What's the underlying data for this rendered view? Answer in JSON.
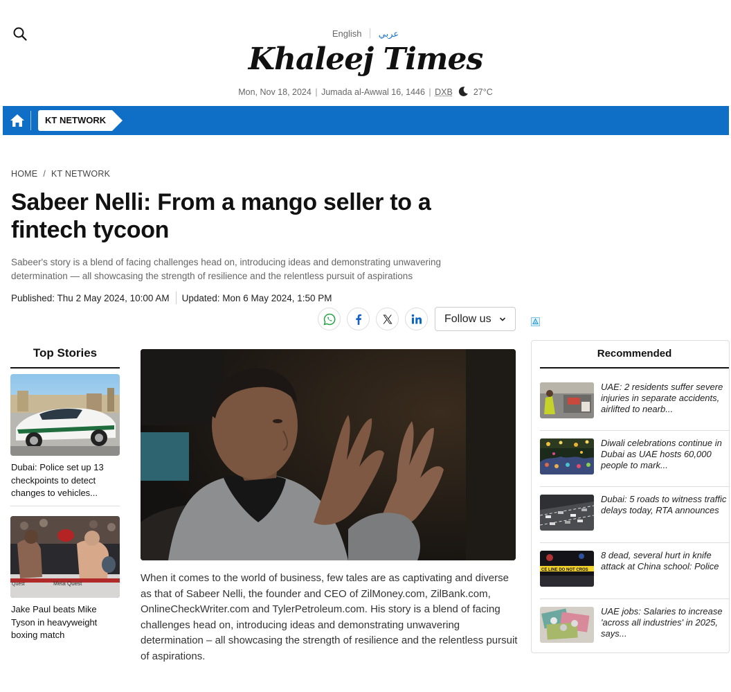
{
  "header": {
    "search_icon": "search-icon",
    "lang_english": "English",
    "lang_arabic": "عربي",
    "logo_text": "Khaleej Times",
    "date_gregorian": "Mon, Nov 18, 2024",
    "date_hijri": "Jumada al-Awwal 16, 1446",
    "city": "DXB",
    "weather_icon": "moon-icon",
    "temperature": "27°C"
  },
  "nav": {
    "home_icon": "home-icon",
    "section_tag": "KT NETWORK",
    "color": "#0f6fc6"
  },
  "article": {
    "breadcrumb": [
      "HOME",
      "KT NETWORK"
    ],
    "breadcrumb_sep": "/",
    "headline": "Sabeer Nelli: From a mango seller to a fintech tycoon",
    "summary": "Sabeer's story is a blend of facing challenges head on, introducing ideas and demonstrating unwavering determination — all showcasing the strength of resilience and the relentless pursuit of aspirations",
    "published": "Published: Thu 2 May 2024, 10:00 AM",
    "updated": "Updated: Mon 6 May 2024, 1:50 PM",
    "share_icons": [
      "whatsapp-icon",
      "facebook-icon",
      "x-icon",
      "linkedin-icon"
    ],
    "follow_label": "Follow us",
    "body": "When it comes to the world of business, few tales are as captivating and diverse as that of Sabeer Nelli, the founder and CEO of ZilMoney.com, ZilBank.com, OnlineCheckWriter.com and TylerPetroleum.com. His story is a blend of facing challenges head on, introducing ideas and demonstrating unwavering determination – all showcasing the strength of resilience and the relentless pursuit of aspirations."
  },
  "top_stories": {
    "title": "Top Stories",
    "items": [
      {
        "text": "Dubai: Police set up 13 checkpoints to detect changes to vehicles..."
      },
      {
        "text": "Jake Paul beats Mike Tyson in heavyweight boxing match"
      }
    ]
  },
  "recommended": {
    "title": "Recommended",
    "items": [
      {
        "text": "UAE: 2 residents suffer severe injuries in separate accidents, airlifted to nearb..."
      },
      {
        "text": "Diwali celebrations continue in Dubai as UAE hosts 60,000 people to mark..."
      },
      {
        "text": "Dubai: 5 roads to witness traffic delays today, RTA announces"
      },
      {
        "text": "8 dead, several hurt in knife attack at China school: Police"
      },
      {
        "text": "UAE jobs: Salaries to increase 'across all industries' in 2025, says..."
      }
    ]
  }
}
